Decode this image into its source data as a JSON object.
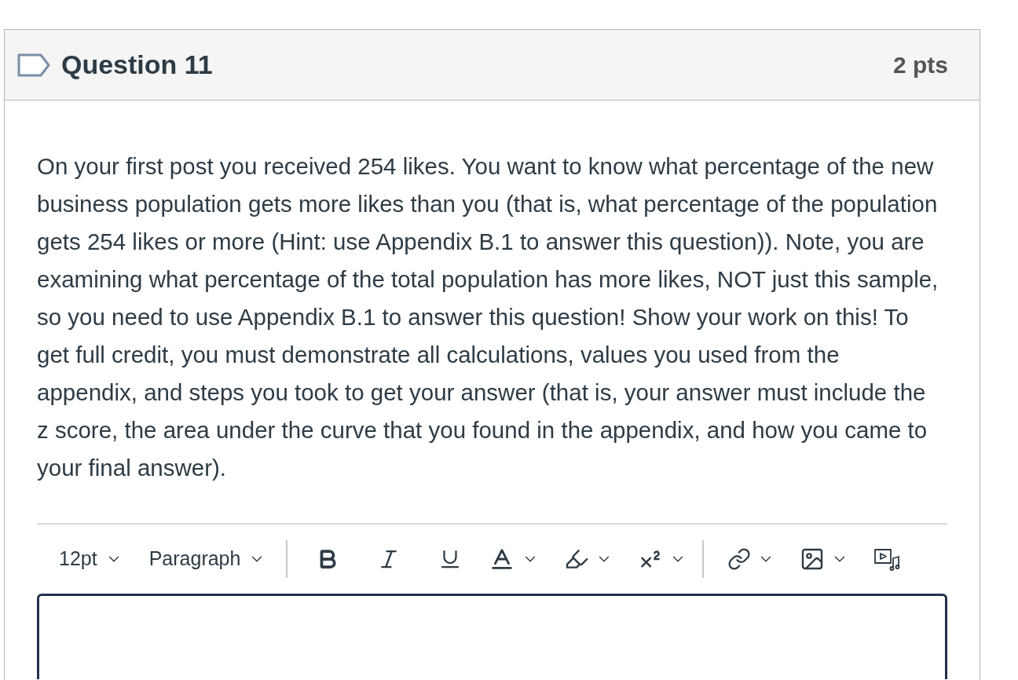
{
  "question": {
    "flagged": false,
    "title": "Question 11",
    "points": "2 pts"
  },
  "prompt": "On your first post you received 254 likes. You want to know what percentage of the new business population gets more likes than you (that is, what percentage of the population gets 254 likes or more (Hint: use Appendix B.1 to answer this question)). Note, you are examining what percentage of the total population has more likes, NOT just this sample, so you need to use Appendix B.1 to answer this question! Show your work on this! To get full credit, you must demonstrate all calculations, values you used from the appendix, and steps you took to get your answer (that is, your answer must include the z score, the area under the curve that you found in the appendix, and how you came to your final answer).",
  "editor_toolbar": {
    "font_size": "12pt",
    "block_format": "Paragraph"
  }
}
